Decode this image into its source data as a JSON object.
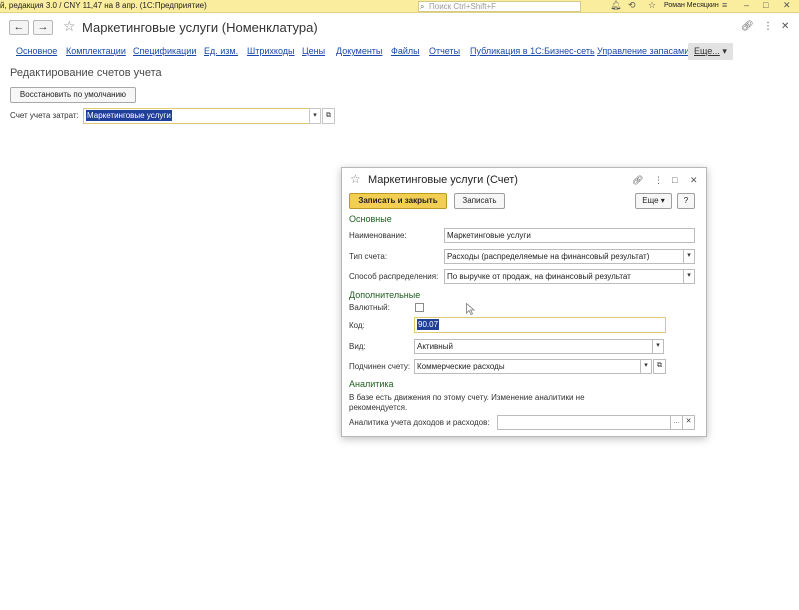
{
  "sysbar": {
    "title": "й, редакция 3.0 / CNY 11,47 на 8 апр.   (1С:Предприятие)",
    "search_placeholder": "Поиск Ctrl+Shift+F",
    "user": "Роман Месяцкин",
    "icons": [
      "bell-icon",
      "history-icon",
      "star-icon",
      "menu-icon",
      "minimize-icon",
      "maximize-icon",
      "close-icon"
    ]
  },
  "form": {
    "title": "Маркетинговые услуги (Номенклатура)",
    "tabs": [
      "Основное",
      "Комплектации",
      "Спецификации",
      "Ед. изм.",
      "Штрихкоды",
      "Цены",
      "Документы",
      "Файлы",
      "Отчеты",
      "Публикация в 1С:Бизнес-сеть",
      "Управление запасами"
    ],
    "more_tab": "Еще...",
    "section_title": "Редактирование счетов учета",
    "restore_button": "Восстановить по умолчанию",
    "cost_account_label": "Счет учета затрат:",
    "cost_account_value": "Маркетинговые услуги"
  },
  "dialog": {
    "title": "Маркетинговые услуги (Счет)",
    "save_close": "Записать и закрыть",
    "save": "Записать",
    "more": "Еще",
    "help": "?",
    "group_main": "Основные",
    "name_label": "Наименование:",
    "name_value": "Маркетинговые услуги",
    "type_label": "Тип счета:",
    "type_value": "Расходы (распределяемые на финансовый результат)",
    "distribution_label": "Способ распределения:",
    "distribution_value": "По выручке от продаж, на финансовый результат",
    "group_additional": "Дополнительные",
    "currency_label": "Валютный:",
    "currency_checked": false,
    "code_label": "Код:",
    "code_value": "90.07",
    "kind_label": "Вид:",
    "kind_value": "Активный",
    "parent_label": "Подчинен счету:",
    "parent_value": "Коммерческие расходы",
    "group_analytics": "Аналитика",
    "analytics_note": "В базе есть движения по этому счету. Изменение аналитики не рекомендуется.",
    "analytics_label": "Аналитика учета доходов и расходов:",
    "analytics_value": ""
  }
}
